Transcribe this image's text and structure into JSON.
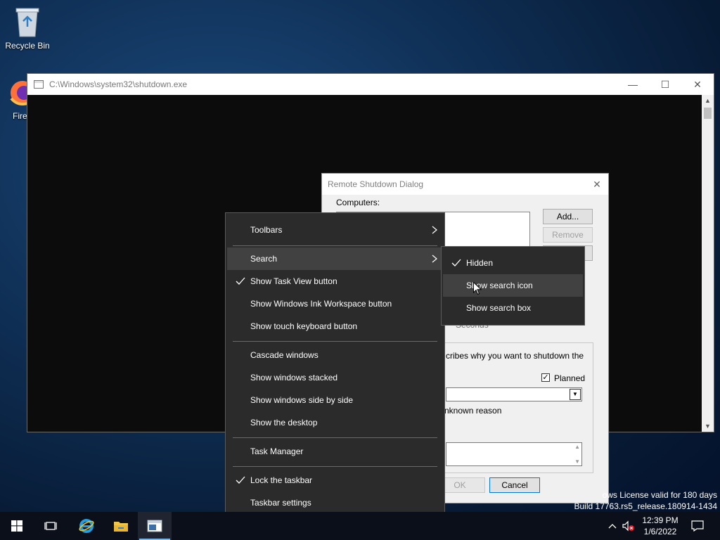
{
  "desktop": {
    "icons": [
      {
        "label": "Recycle Bin"
      },
      {
        "label": "Fire"
      }
    ],
    "watermark": {
      "line1": "ows License valid for 180 days",
      "line2": "Build 17763.rs5_release.180914-1434"
    }
  },
  "console": {
    "title": "C:\\Windows\\system32\\shutdown.exe",
    "minimize": "—",
    "maximize": "☐",
    "close": "✕"
  },
  "dialog": {
    "title": "Remote Shutdown Dialog",
    "computers_label": "Computers:",
    "add_button": "Add...",
    "remove_button": "Remove",
    "seconds_label": "Seconds",
    "reason_text": "cribes why you want to shutdown the",
    "planned_label": "Planned",
    "planned_checked": true,
    "unknown_reason": "nknown reason",
    "ok_button": "OK",
    "cancel_button": "Cancel",
    "close": "✕"
  },
  "context_menu": {
    "items": [
      {
        "label": "Toolbars",
        "submenu": true
      },
      {
        "label": "Search",
        "submenu": true,
        "highlighted": true
      },
      {
        "label": "Show Task View button",
        "checked": true
      },
      {
        "label": "Show Windows Ink Workspace button"
      },
      {
        "label": "Show touch keyboard button"
      },
      {
        "label": "Cascade windows"
      },
      {
        "label": "Show windows stacked"
      },
      {
        "label": "Show windows side by side"
      },
      {
        "label": "Show the desktop"
      },
      {
        "label": "Task Manager"
      },
      {
        "label": "Lock the taskbar",
        "checked": true
      },
      {
        "label": "Taskbar settings"
      }
    ]
  },
  "search_submenu": {
    "items": [
      {
        "label": "Hidden",
        "checked": true
      },
      {
        "label": "Show search icon",
        "highlighted": true
      },
      {
        "label": "Show search box"
      }
    ]
  },
  "taskbar": {
    "time": "12:39 PM",
    "date": "1/6/2022",
    "accent": "#76b9ed"
  }
}
